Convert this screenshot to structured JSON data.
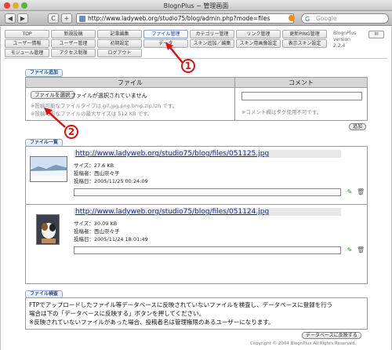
{
  "window": {
    "title": "BlognPlus − 管理画面"
  },
  "browser": {
    "back_glyph": "◀",
    "forward_glyph": "▶",
    "reload_glyph": "C",
    "add_glyph": "+",
    "url": "http://www.ladyweb.org/studio75/blog/admin.php?mode=files",
    "search_placeholder": "Google",
    "search_glyph": "G"
  },
  "nav": {
    "row1": [
      "TOP",
      "新規投稿",
      "記事編集",
      "ファイル管理",
      "カテゴリー管理",
      "リンク管理",
      "更新PING管理"
    ],
    "row2": [
      "ユーザー情報",
      "ユーザー管理",
      "初期設定",
      "データ",
      "スキン追加／編集",
      "スキン用画像設定",
      "表示スキン設定"
    ],
    "row3": [
      "モジュール管理",
      "アクセス制限",
      "ログアウト"
    ],
    "active": "ファイル管理",
    "version_name": "BlognPlus",
    "version_label": "version",
    "version_number": "2.2.4",
    "mail_glyph": "✉"
  },
  "upload": {
    "section_label": "ファイル追加",
    "col_file": "ファイル",
    "col_comment": "コメント",
    "choose_button": "ファイルを選択",
    "no_file": "ファイルが選択されていません",
    "note_types": "※投稿可能なファイルタイプは gif,jpg,png,bmp,zip,lzh です。",
    "note_size": "※投稿可能なファイルの最大サイズは 512 KB です。",
    "comment_note": "※コメント欄はタグ使用不可です。",
    "add_button": "追加"
  },
  "files": {
    "section_label": "ファイル一覧",
    "items": [
      {
        "url": "http://www.ladyweb.org/studio75/blog/files/051125.jpg",
        "size": "サイズ：27.6 KB",
        "poster": "投稿者：西山奈々子",
        "date": "投稿日：2005/11/25 00:24:09"
      },
      {
        "url": "http://www.ladyweb.org/studio75/blog/files/051124.jpg",
        "size": "サイズ：30.09 KB",
        "poster": "投稿者：西山奈々子",
        "date": "投稿日：2005/11/24 18:01:49"
      }
    ],
    "edit_glyph": "✎",
    "delete_glyph": "🗑"
  },
  "check": {
    "section_label": "ファイル検査",
    "line1": "FTPでアップロードしたファイル等データベースに反映されていないファイルを検査し、データベースに登録を行う",
    "line2": "場合は下の「データベースに反映する」ボタンを押してください。",
    "line3": "※反映されていないファイルがあった場合、投稿者名は管理権限のあるユーザーになります。",
    "apply_button": "データベースに反映する"
  },
  "footer": {
    "copyright": "Copyright © 2004 BlognPlus All Rights Reserved."
  },
  "annotations": [
    "1",
    "2"
  ],
  "colors": {
    "accent": "#23478f",
    "annotation": "#e01010",
    "link": "#1a2da3"
  }
}
